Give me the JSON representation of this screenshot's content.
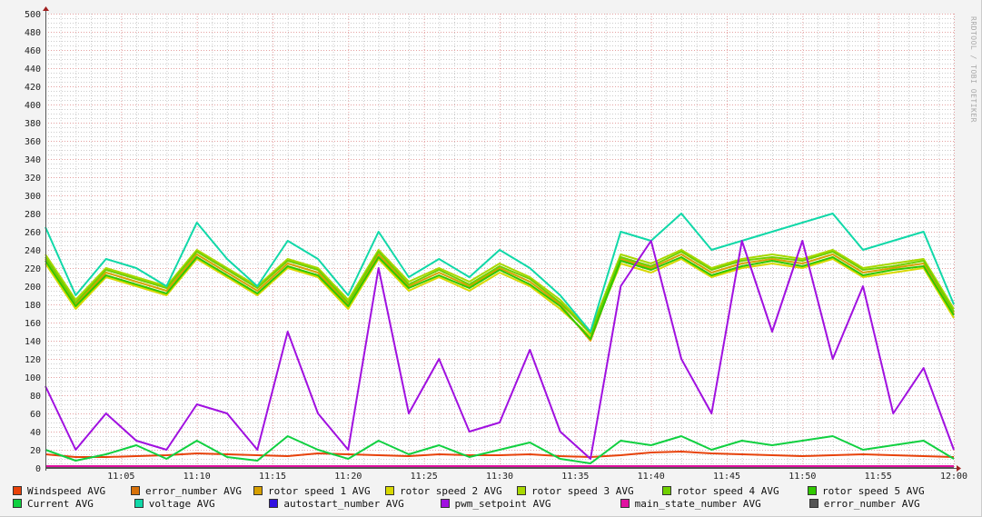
{
  "watermark": "RRDTOOL / TOBI OETIKER",
  "chart_data": {
    "type": "line",
    "title": "",
    "xlabel": "",
    "ylabel": "",
    "ylim": [
      0,
      500
    ],
    "yticks": [
      0,
      20,
      40,
      60,
      80,
      100,
      120,
      140,
      160,
      180,
      200,
      220,
      240,
      260,
      280,
      300,
      320,
      340,
      360,
      380,
      400,
      420,
      440,
      460,
      480,
      500
    ],
    "x_minutes": [
      0,
      2,
      4,
      6,
      8,
      10,
      12,
      14,
      16,
      18,
      20,
      22,
      24,
      26,
      28,
      30,
      32,
      34,
      36,
      38,
      40,
      42,
      44,
      46,
      48,
      50,
      52,
      54,
      56,
      58,
      60
    ],
    "xticks": [
      {
        "min": 5,
        "label": "11:05"
      },
      {
        "min": 10,
        "label": "11:10"
      },
      {
        "min": 15,
        "label": "11:15"
      },
      {
        "min": 20,
        "label": "11:20"
      },
      {
        "min": 25,
        "label": "11:25"
      },
      {
        "min": 30,
        "label": "11:30"
      },
      {
        "min": 35,
        "label": "11:35"
      },
      {
        "min": 40,
        "label": "11:40"
      },
      {
        "min": 45,
        "label": "11:45"
      },
      {
        "min": 50,
        "label": "11:50"
      },
      {
        "min": 55,
        "label": "11:55"
      },
      {
        "min": 60,
        "label": "12:00"
      }
    ],
    "grid": true,
    "legend_position": "bottom",
    "series": [
      {
        "name": "Windspeed AVG",
        "color": "#e8420a",
        "values": [
          15,
          12,
          12,
          13,
          14,
          16,
          15,
          14,
          13,
          16,
          15,
          14,
          13,
          15,
          14,
          14,
          15,
          13,
          12,
          14,
          17,
          18,
          16,
          15,
          14,
          13,
          14,
          15,
          14,
          13,
          12
        ]
      },
      {
        "name": "error_number AVG",
        "color": "#d8720a",
        "values": [
          0,
          0,
          0,
          0,
          0,
          0,
          0,
          0,
          0,
          0,
          0,
          0,
          0,
          0,
          0,
          0,
          0,
          0,
          0,
          0,
          0,
          0,
          0,
          0,
          0,
          0,
          0,
          0,
          0,
          0,
          0
        ]
      },
      {
        "name": "rotor speed 1 AVG",
        "color": "#d8a000",
        "values": [
          230,
          180,
          215,
          205,
          195,
          235,
          215,
          195,
          225,
          215,
          180,
          235,
          200,
          215,
          200,
          220,
          205,
          180,
          140,
          230,
          220,
          235,
          215,
          225,
          230,
          225,
          235,
          215,
          220,
          225,
          170
        ]
      },
      {
        "name": "rotor speed 2 AVG",
        "color": "#d8d800",
        "values": [
          225,
          175,
          210,
          200,
          190,
          230,
          210,
          190,
          220,
          210,
          175,
          230,
          195,
          210,
          195,
          215,
          200,
          175,
          145,
          225,
          215,
          230,
          210,
          220,
          225,
          220,
          230,
          210,
          215,
          220,
          165
        ]
      },
      {
        "name": "rotor speed 3 AVG",
        "color": "#a8d800",
        "values": [
          235,
          185,
          220,
          210,
          200,
          240,
          220,
          200,
          230,
          220,
          185,
          240,
          205,
          220,
          205,
          225,
          210,
          185,
          150,
          235,
          225,
          240,
          220,
          230,
          235,
          230,
          240,
          220,
          225,
          230,
          175
        ]
      },
      {
        "name": "rotor speed 4 AVG",
        "color": "#70d000",
        "values": [
          232,
          182,
          218,
          208,
          198,
          238,
          218,
          198,
          228,
          218,
          182,
          238,
          202,
          218,
          202,
          222,
          208,
          182,
          148,
          232,
          222,
          238,
          218,
          228,
          232,
          228,
          238,
          218,
          222,
          228,
          172
        ]
      },
      {
        "name": "rotor speed 5 AVG",
        "color": "#30c800",
        "values": [
          228,
          178,
          212,
          202,
          192,
          232,
          212,
          192,
          222,
          212,
          178,
          232,
          198,
          212,
          198,
          218,
          202,
          178,
          142,
          228,
          218,
          232,
          212,
          222,
          228,
          222,
          232,
          212,
          218,
          222,
          168
        ]
      },
      {
        "name": "Current AVG",
        "color": "#10d040",
        "values": [
          20,
          8,
          15,
          25,
          10,
          30,
          12,
          8,
          35,
          20,
          10,
          30,
          15,
          25,
          12,
          20,
          28,
          10,
          5,
          30,
          25,
          35,
          20,
          30,
          25,
          30,
          35,
          20,
          25,
          30,
          10
        ]
      },
      {
        "name": "voltage AVG",
        "color": "#10d8a8",
        "values": [
          265,
          190,
          230,
          220,
          200,
          270,
          230,
          200,
          250,
          230,
          190,
          260,
          210,
          230,
          210,
          240,
          220,
          190,
          150,
          260,
          250,
          280,
          240,
          250,
          260,
          270,
          280,
          240,
          250,
          260,
          180
        ]
      },
      {
        "name": "autostart_number AVG",
        "color": "#3010e0",
        "values": [
          0,
          0,
          0,
          0,
          0,
          0,
          0,
          0,
          0,
          0,
          0,
          0,
          0,
          0,
          0,
          0,
          0,
          0,
          0,
          0,
          0,
          0,
          0,
          0,
          0,
          0,
          0,
          0,
          0,
          0,
          0
        ]
      },
      {
        "name": "pwm_setpoint AVG",
        "color": "#a010e0",
        "values": [
          90,
          20,
          60,
          30,
          20,
          70,
          60,
          20,
          150,
          60,
          20,
          220,
          60,
          120,
          40,
          50,
          130,
          40,
          10,
          200,
          250,
          120,
          60,
          250,
          150,
          250,
          120,
          200,
          60,
          110,
          20
        ]
      },
      {
        "name": "main_state_number AVG",
        "color": "#e010a0",
        "values": [
          2,
          2,
          2,
          2,
          2,
          2,
          2,
          2,
          2,
          2,
          2,
          2,
          2,
          2,
          2,
          2,
          2,
          2,
          2,
          2,
          2,
          2,
          2,
          2,
          2,
          2,
          2,
          2,
          2,
          2,
          2
        ]
      },
      {
        "name": "error_number AVG",
        "color": "#555555",
        "values": [
          0,
          0,
          0,
          0,
          0,
          0,
          0,
          0,
          0,
          0,
          0,
          0,
          0,
          0,
          0,
          0,
          0,
          0,
          0,
          0,
          0,
          0,
          0,
          0,
          0,
          0,
          0,
          0,
          0,
          0,
          0
        ]
      }
    ]
  }
}
